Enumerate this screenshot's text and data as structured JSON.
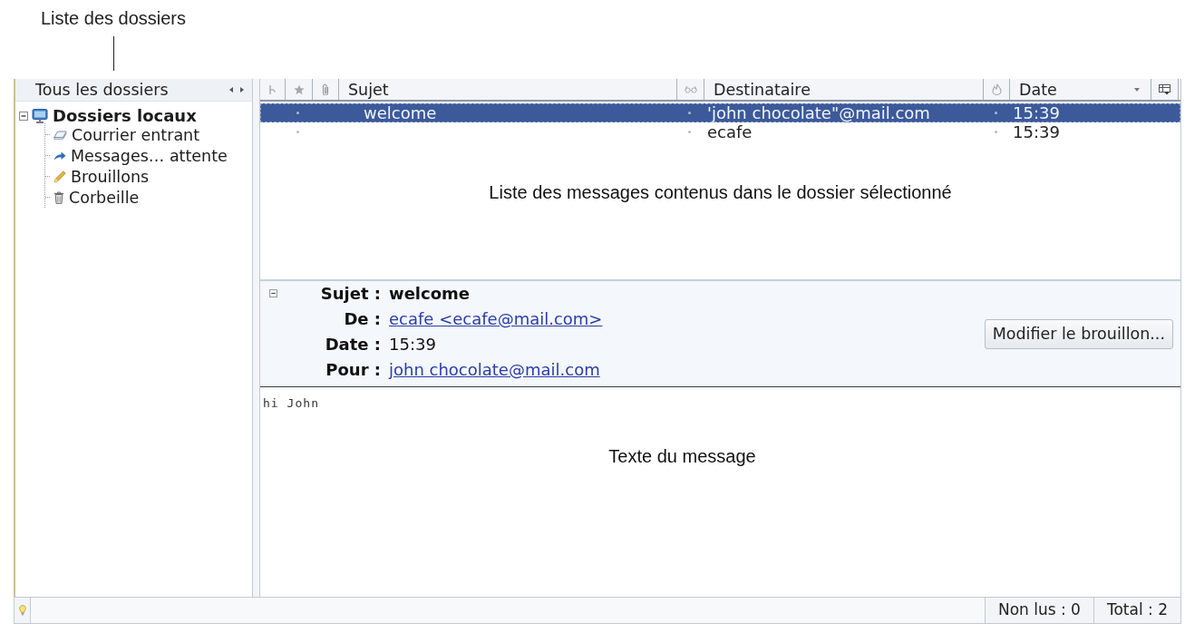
{
  "callout": {
    "text": "Liste des dossiers"
  },
  "folder_pane": {
    "header": "Tous les dossiers",
    "tree": [
      {
        "label": "Dossiers locaux",
        "kind": "account",
        "expanded": true,
        "selected": false,
        "children": [
          {
            "label": "Courrier entrant",
            "kind": "inbox",
            "selected": false
          },
          {
            "label": "Messages… attente",
            "kind": "outbox",
            "selected": false
          },
          {
            "label": "Brouillons",
            "kind": "drafts",
            "selected": false
          },
          {
            "label": "Corbeille",
            "kind": "trash",
            "selected": false
          }
        ]
      }
    ]
  },
  "message_list": {
    "columns": [
      {
        "kind": "thread",
        "sorted": false
      },
      {
        "kind": "flag",
        "sorted": false
      },
      {
        "kind": "attachment",
        "sorted": false
      },
      {
        "kind": "text",
        "label": "Sujet",
        "sorted": false
      },
      {
        "kind": "read",
        "sorted": false
      },
      {
        "kind": "text",
        "label": "Destinataire",
        "sorted": false
      },
      {
        "kind": "junk",
        "sorted": false
      },
      {
        "kind": "text",
        "label": "Date",
        "sorted": true
      },
      {
        "kind": "picker",
        "sorted": false
      }
    ],
    "rows": [
      {
        "selected": true,
        "subject": "welcome",
        "recipient": "'john chocolate\"@mail.com",
        "date": "15:39"
      },
      {
        "selected": false,
        "recipient": "ecafe",
        "date": "15:39"
      }
    ],
    "annotation": "Liste des messages contenus dans le dossier sélectionné"
  },
  "message_header": {
    "expanded": true,
    "fields": [
      {
        "label": "Sujet :",
        "value": "welcome",
        "kind": "bold"
      },
      {
        "label": "De :",
        "value": "ecafe <ecafe@mail.com>",
        "kind": "link"
      },
      {
        "label": "Date :",
        "value": "15:39",
        "kind": "plain"
      },
      {
        "label": "Pour :",
        "value": "john chocolate@mail.com",
        "kind": "link"
      }
    ],
    "button": "Modifier le brouillon..."
  },
  "message_body": {
    "text": "hi John",
    "annotation": "Texte du message"
  },
  "status_bar": {
    "fields": [
      "Non lus : 0",
      "Total : 2"
    ]
  }
}
